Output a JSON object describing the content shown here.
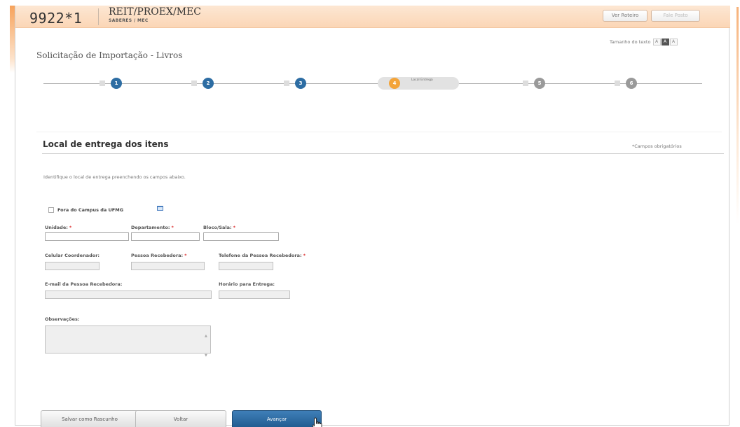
{
  "header": {
    "code": "9922*1",
    "org_title": "REIT/PROEX/MEC",
    "org_subtitle": "SABERES / MEC",
    "btn_view": "Ver Roteiro",
    "btn_print": "Fale Posto"
  },
  "font_size": {
    "label": "Tamanho do texto",
    "options": [
      "A",
      "A",
      "A"
    ]
  },
  "page_title": "Solicitação de Importação - Livros",
  "stepper": {
    "steps": [
      {
        "number": "1",
        "state": "done"
      },
      {
        "number": "2",
        "state": "done"
      },
      {
        "number": "3",
        "state": "done"
      },
      {
        "number": "4",
        "state": "current",
        "label": "Local Entrega"
      },
      {
        "number": "5",
        "state": "todo"
      },
      {
        "number": "6",
        "state": "todo"
      }
    ]
  },
  "section": {
    "title": "Local de entrega dos itens",
    "required_note": "*Campos obrigatórios",
    "instruction": "Identifique o local de entrega preenchendo os campos abaixo."
  },
  "form": {
    "outside_campus_label": "Fora do Campus da UFMG",
    "unidade_label": "Unidade:",
    "departamento_label": "Departamento:",
    "bloco_label": "Bloco/Sala:",
    "celular_label": "Celular Coordenador:",
    "pessoa_label": "Pessoa Recebedora:",
    "telefone_label": "Telefone da Pessoa Recebedora:",
    "email_label": "E-mail da Pessoa Recebedora:",
    "horario_label": "Horário para Entrega:",
    "observacoes_label": "Observações:",
    "required_mark": "*"
  },
  "buttons": {
    "save_draft": "Salvar como Rascunho",
    "back": "Voltar",
    "next": "Avançar"
  },
  "colors": {
    "header_bg": "#fbd6b6",
    "step_done": "#2d6da3",
    "step_current": "#f3a43a",
    "step_todo": "#9a9a9a",
    "primary_button": "#2a6aa3"
  }
}
